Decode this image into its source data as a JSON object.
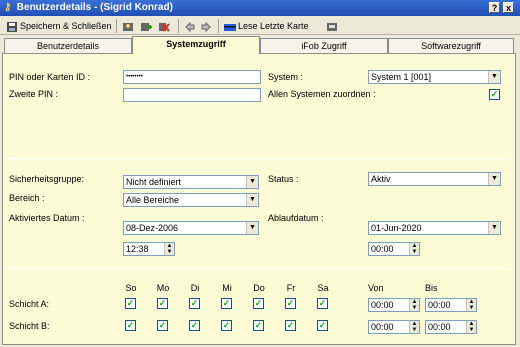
{
  "window": {
    "title": "Benutzerdetails - (Sigrid Konrad)",
    "help": "?",
    "close": "x"
  },
  "toolbar": {
    "save_close": "Speichern & Schließen",
    "read_card": "Lese Letzte Karte"
  },
  "tabs": [
    "Benutzerdetails",
    "Systemzugriff",
    "iFob Zugriff",
    "Softwarezugriff"
  ],
  "access": {
    "pin_label": "PIN oder Karten ID :",
    "pin_value": "••••••••",
    "second_pin_label": "Zweite PIN :",
    "second_pin_value": "",
    "system_label": "System :",
    "system_value": "System 1 [001]",
    "all_systems_label": "Allen Systemen zuordnen :",
    "all_systems_checked": true
  },
  "security": {
    "group_label": "Sicherheitsgruppe:",
    "group_value": "Nicht definiert",
    "area_label": "Bereich :",
    "area_value": "Alle Bereiche",
    "activated_label": "Aktiviertes Datum :",
    "activated_date": "08-Dez-2006",
    "activated_time": "12:38",
    "status_label": "Status :",
    "status_value": "Aktiv",
    "expiry_label": "Ablaufdatum :",
    "expiry_date": "01-Jun-2020",
    "expiry_time": "00:00"
  },
  "shifts": {
    "days": [
      "So",
      "Mo",
      "Di",
      "Mi",
      "Do",
      "Fr",
      "Sa"
    ],
    "from_label": "Von",
    "to_label": "Bis",
    "rows": [
      {
        "label": "Schicht A:",
        "checked": [
          true,
          true,
          true,
          true,
          true,
          true,
          true
        ],
        "from": "00:00",
        "to": "00:00"
      },
      {
        "label": "Schicht B:",
        "checked": [
          true,
          true,
          true,
          true,
          true,
          true,
          true
        ],
        "from": "00:00",
        "to": "00:00"
      }
    ]
  }
}
